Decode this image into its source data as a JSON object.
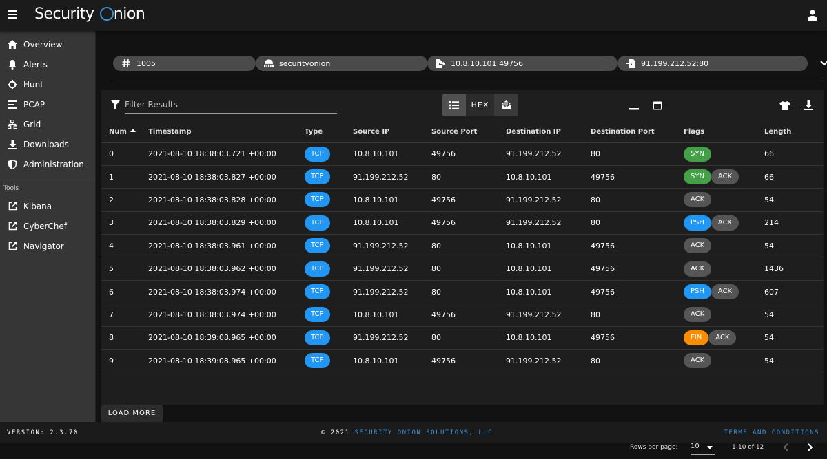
{
  "app": {
    "logo_text": "Security",
    "logo_text2": "nion"
  },
  "sidebar": {
    "items": [
      {
        "label": "Overview",
        "icon": "home-icon"
      },
      {
        "label": "Alerts",
        "icon": "bell-icon"
      },
      {
        "label": "Hunt",
        "icon": "crosshairs-icon"
      },
      {
        "label": "PCAP",
        "icon": "lines-icon"
      },
      {
        "label": "Grid",
        "icon": "sitemap-icon"
      },
      {
        "label": "Downloads",
        "icon": "download-icon"
      },
      {
        "label": "Administration",
        "icon": "shield-icon"
      }
    ],
    "tools_label": "Tools",
    "tools": [
      {
        "label": "Kibana",
        "icon": "external-link-icon"
      },
      {
        "label": "CyberChef",
        "icon": "external-link-icon"
      },
      {
        "label": "Navigator",
        "icon": "external-link-icon"
      }
    ]
  },
  "chips": [
    {
      "label": "1005",
      "icon": "hash-icon"
    },
    {
      "label": "securityonion",
      "icon": "network-icon"
    },
    {
      "label": "10.8.10.101:49756",
      "icon": "file-export-icon"
    },
    {
      "label": "91.199.212.52:80",
      "icon": "file-import-icon"
    }
  ],
  "toolbar": {
    "filter_placeholder": "Filter Results",
    "hex_label": "HEX"
  },
  "table": {
    "headers": [
      "Num",
      "Timestamp",
      "Type",
      "Source IP",
      "Source Port",
      "Destination IP",
      "Destination Port",
      "Flags",
      "Length"
    ],
    "rows": [
      {
        "num": "0",
        "ts": "2021-08-10 18:38:03.721 +00:00",
        "type": "TCP",
        "src": "10.8.10.101",
        "sport": "49756",
        "dst": "91.199.212.52",
        "dport": "80",
        "flags": [
          "SYN"
        ],
        "len": "66"
      },
      {
        "num": "1",
        "ts": "2021-08-10 18:38:03.827 +00:00",
        "type": "TCP",
        "src": "91.199.212.52",
        "sport": "80",
        "dst": "10.8.10.101",
        "dport": "49756",
        "flags": [
          "SYN",
          "ACK"
        ],
        "len": "66"
      },
      {
        "num": "2",
        "ts": "2021-08-10 18:38:03.828 +00:00",
        "type": "TCP",
        "src": "10.8.10.101",
        "sport": "49756",
        "dst": "91.199.212.52",
        "dport": "80",
        "flags": [
          "ACK"
        ],
        "len": "54"
      },
      {
        "num": "3",
        "ts": "2021-08-10 18:38:03.829 +00:00",
        "type": "TCP",
        "src": "10.8.10.101",
        "sport": "49756",
        "dst": "91.199.212.52",
        "dport": "80",
        "flags": [
          "PSH",
          "ACK"
        ],
        "len": "214"
      },
      {
        "num": "4",
        "ts": "2021-08-10 18:38:03.961 +00:00",
        "type": "TCP",
        "src": "91.199.212.52",
        "sport": "80",
        "dst": "10.8.10.101",
        "dport": "49756",
        "flags": [
          "ACK"
        ],
        "len": "54"
      },
      {
        "num": "5",
        "ts": "2021-08-10 18:38:03.962 +00:00",
        "type": "TCP",
        "src": "91.199.212.52",
        "sport": "80",
        "dst": "10.8.10.101",
        "dport": "49756",
        "flags": [
          "ACK"
        ],
        "len": "1436"
      },
      {
        "num": "6",
        "ts": "2021-08-10 18:38:03.974 +00:00",
        "type": "TCP",
        "src": "91.199.212.52",
        "sport": "80",
        "dst": "10.8.10.101",
        "dport": "49756",
        "flags": [
          "PSH",
          "ACK"
        ],
        "len": "607"
      },
      {
        "num": "7",
        "ts": "2021-08-10 18:38:03.974 +00:00",
        "type": "TCP",
        "src": "10.8.10.101",
        "sport": "49756",
        "dst": "91.199.212.52",
        "dport": "80",
        "flags": [
          "ACK"
        ],
        "len": "54"
      },
      {
        "num": "8",
        "ts": "2021-08-10 18:39:08.965 +00:00",
        "type": "TCP",
        "src": "91.199.212.52",
        "sport": "80",
        "dst": "10.8.10.101",
        "dport": "49756",
        "flags": [
          "FIN",
          "ACK"
        ],
        "len": "54"
      },
      {
        "num": "9",
        "ts": "2021-08-10 18:39:08.965 +00:00",
        "type": "TCP",
        "src": "10.8.10.101",
        "sport": "49756",
        "dst": "91.199.212.52",
        "dport": "80",
        "flags": [
          "ACK"
        ],
        "len": "54"
      }
    ]
  },
  "pagination": {
    "rows_per_page_label": "Rows per page:",
    "rows_per_page_value": "10",
    "range_text": "1-10 of 12"
  },
  "load_more_label": "LOAD MORE",
  "footer": {
    "version": "VERSION: 2.3.70",
    "copyright_prefix": "© 2021",
    "copyright_link": "SECURITY ONION SOLUTIONS, LLC",
    "terms": "TERMS AND CONDITIONS"
  },
  "colors": {
    "accent": "#2196f3",
    "syn": "#43a047",
    "fin": "#fb8c00",
    "ack": "#555555",
    "link": "#3d8fd4"
  }
}
